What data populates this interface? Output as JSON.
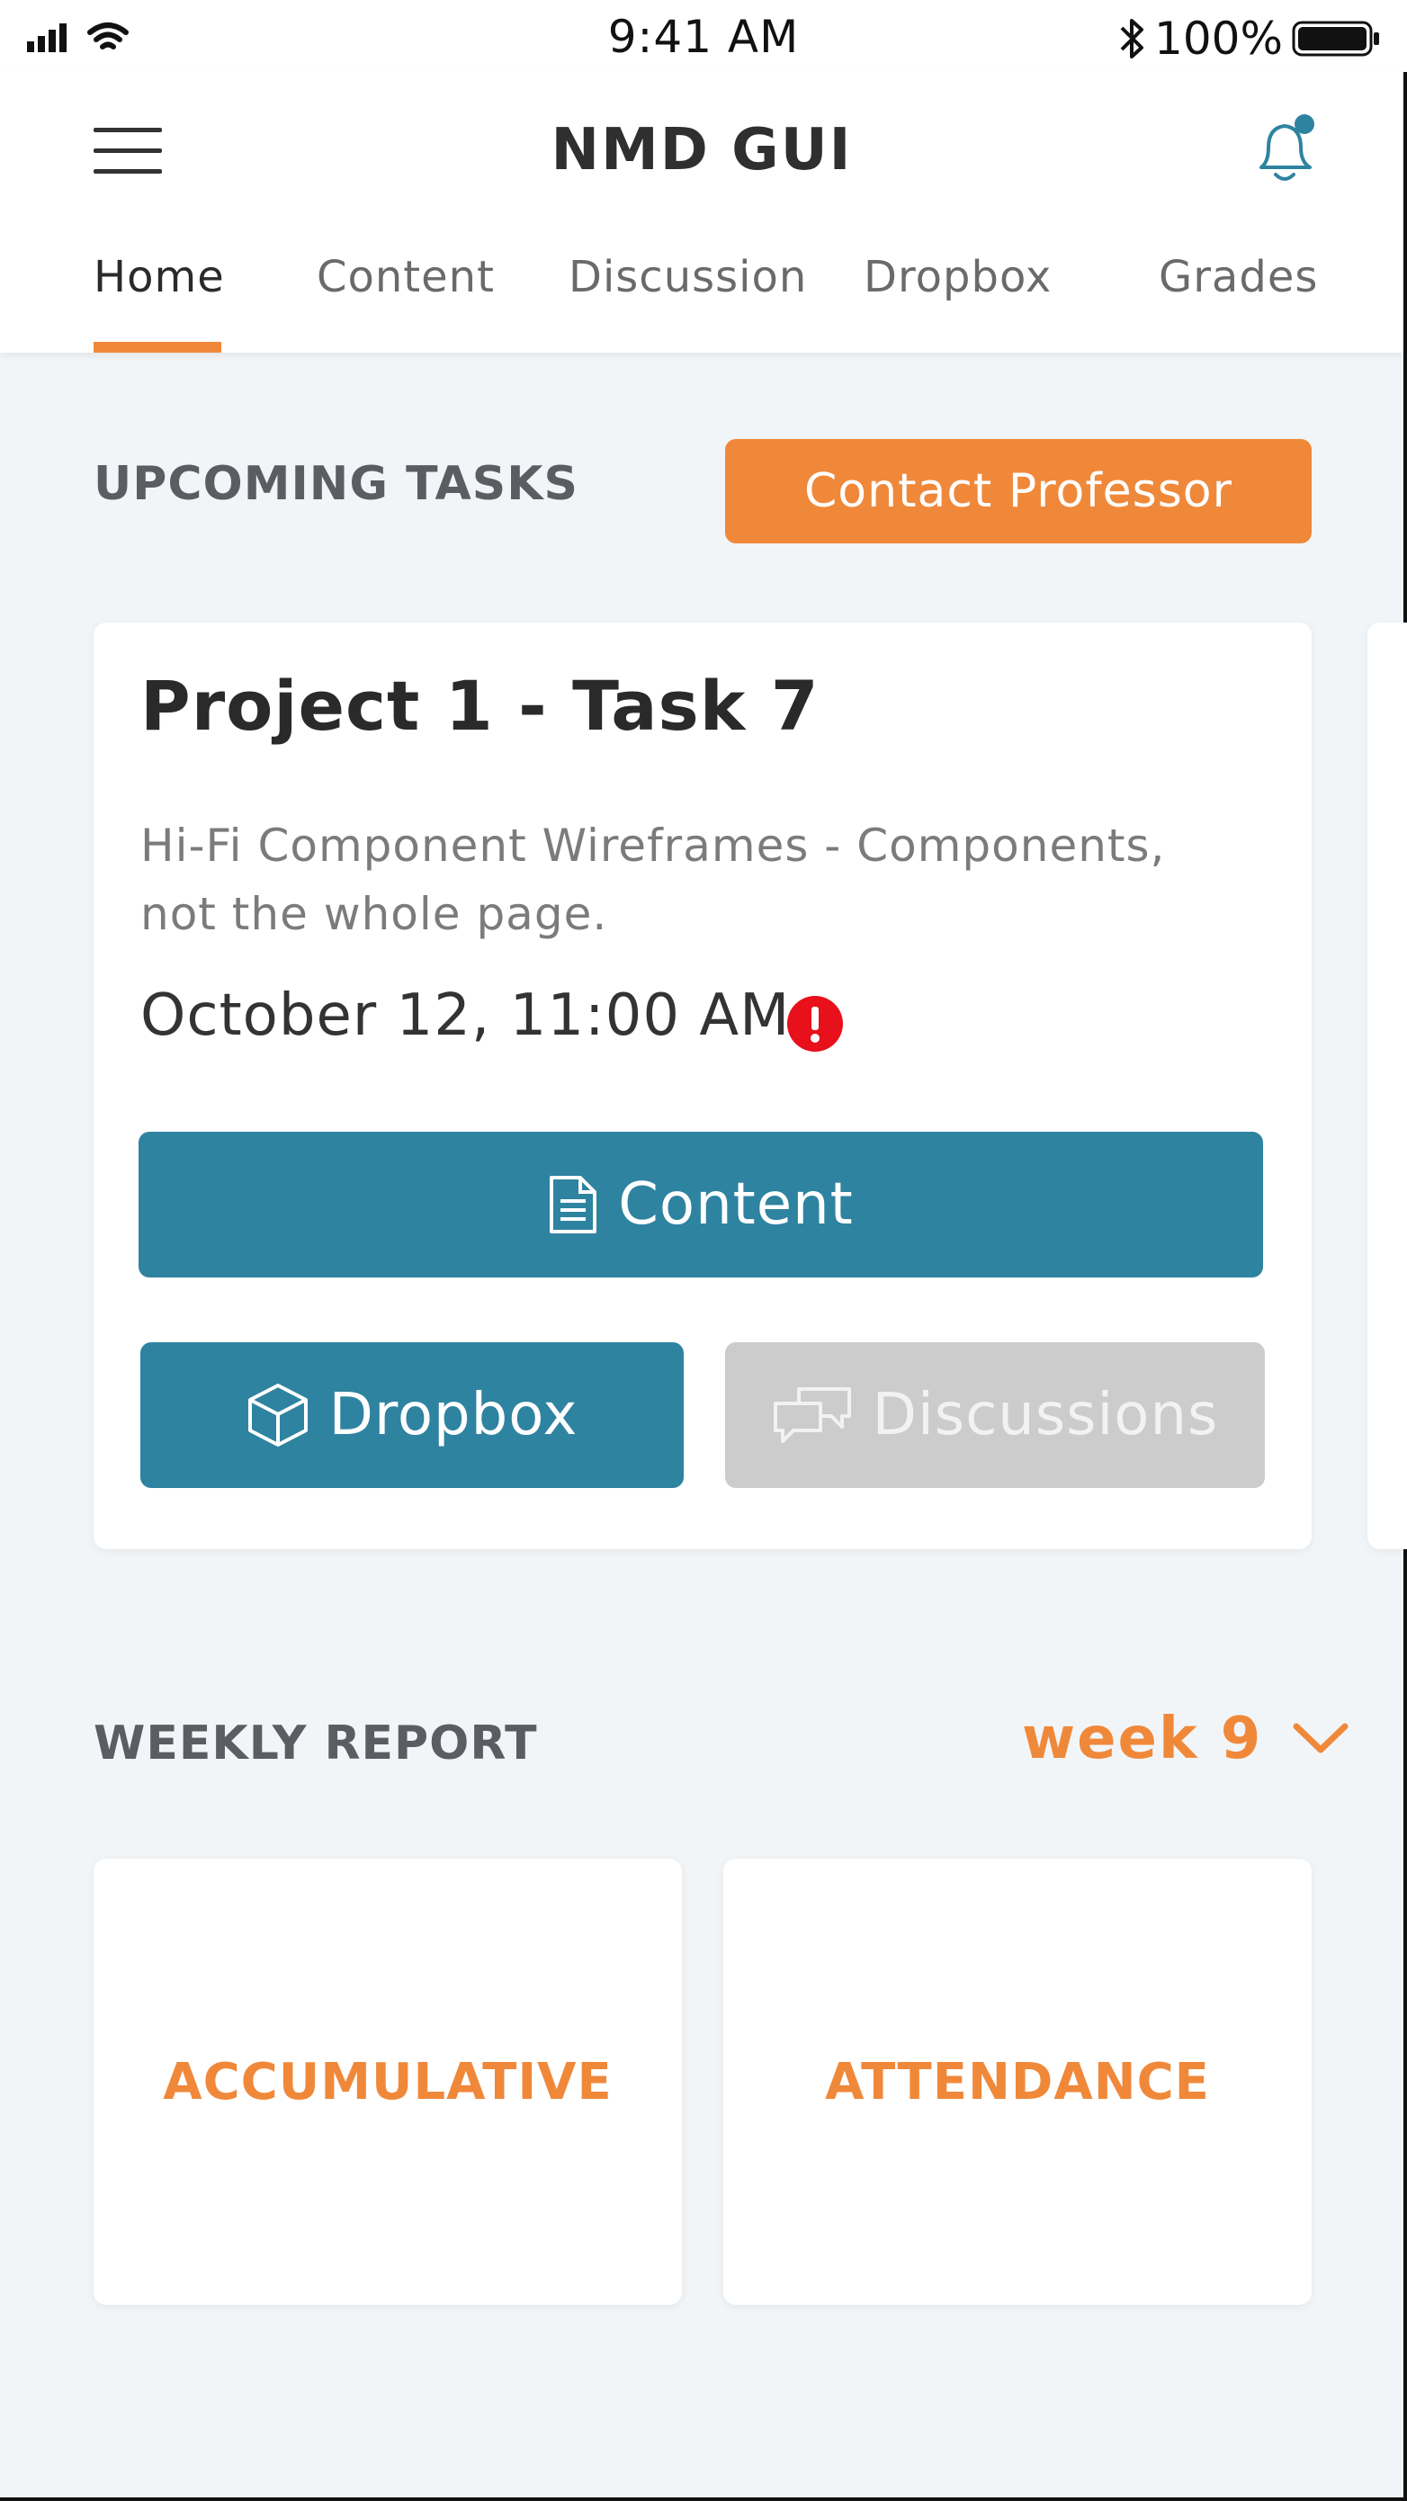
{
  "status_bar": {
    "time": "9:41 AM",
    "battery": "100%",
    "icons": [
      "signal-icon",
      "wifi-icon",
      "bluetooth-icon",
      "battery-icon"
    ]
  },
  "header": {
    "title": "NMD GUI",
    "menu_icon": "hamburger-icon",
    "notification_icon": "bell-icon",
    "tabs": [
      {
        "label": "Home",
        "active": true
      },
      {
        "label": "Content",
        "active": false
      },
      {
        "label": "Discussion",
        "active": false
      },
      {
        "label": "Dropbox",
        "active": false
      },
      {
        "label": "Grades",
        "active": false
      }
    ]
  },
  "upcoming": {
    "title": "UPCOMING TASKS",
    "contact_button": "Contact Professor",
    "task": {
      "title": "Project 1 - Task 7",
      "description": "Hi-Fi Component Wireframes - Components, not the whole page.",
      "due": "October 12, 11:00 AM",
      "alert_icon": "alert-icon",
      "buttons": {
        "content": "Content",
        "dropbox": "Dropbox",
        "discussions": "Discussions"
      }
    }
  },
  "weekly_report": {
    "title": "WEEKLY REPORT",
    "week": "week 9",
    "cards": [
      "ACCUMULATIVE",
      "ATTENDANCE"
    ]
  },
  "colors": {
    "accent_orange": "#f0883a",
    "primary_teal": "#2e83a0",
    "disabled_gray": "#cccccc",
    "background": "#f2f5f7",
    "alert_red": "#e8101a"
  }
}
